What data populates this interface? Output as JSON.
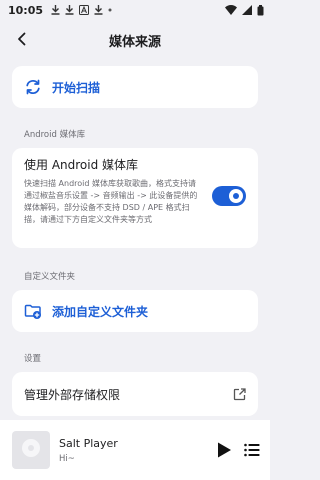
{
  "status_bar": {
    "time": "10:05"
  },
  "app_bar": {
    "title": "媒体来源"
  },
  "scan": {
    "label": "开始扫描"
  },
  "android_section": {
    "header": "Android 媒体库",
    "toggle_title": "使用 Android 媒体库",
    "toggle_description": "快速扫描 Android 媒体库获取歌曲，格式支持请通过椒盐音乐设置 -> 音频输出 -> 此设备提供的媒体解码，部分设备不支持 DSD / APE 格式扫描，请通过下方自定义文件夹等方式",
    "toggle_on": true
  },
  "custom_folder_section": {
    "header": "自定义文件夹",
    "add_label": "添加自定义文件夹"
  },
  "settings_section": {
    "header": "设置",
    "storage_permission_label": "管理外部存储权限"
  },
  "mini_player": {
    "title": "Salt Player",
    "subtitle": "Hi~"
  },
  "colors": {
    "accent": "#1d5fd6",
    "background": "#f1f1f5",
    "card": "#ffffff",
    "secondary_text": "#6c6c72"
  },
  "icons": {
    "back": "arrow-left-icon",
    "scan": "refresh-icon",
    "add_folder": "folder-add-icon",
    "open": "open-external-icon",
    "play": "play-icon",
    "queue": "queue-list-icon"
  }
}
